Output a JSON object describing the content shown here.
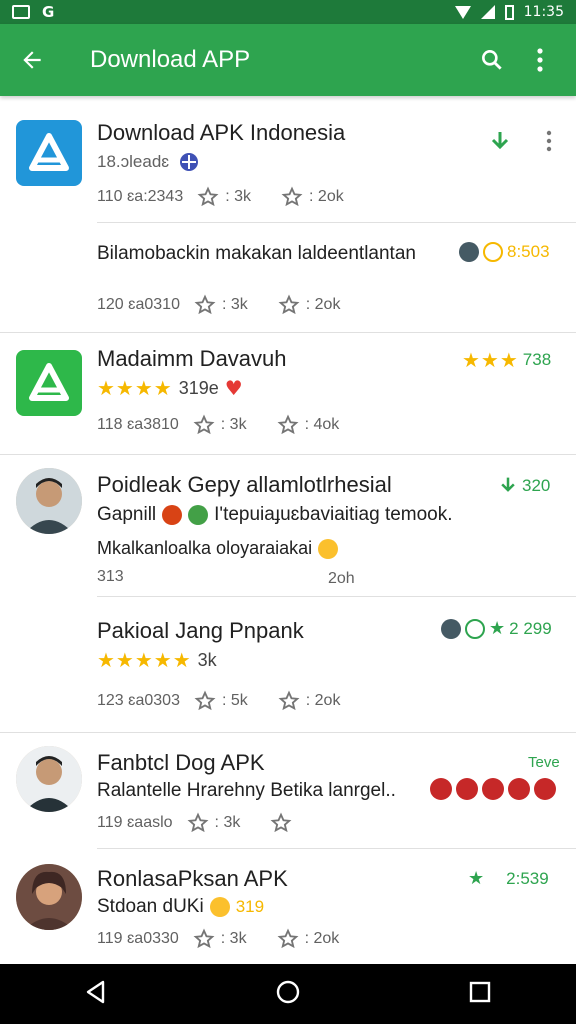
{
  "status_bar": {
    "time": "11:35"
  },
  "app_bar": {
    "title": "Download APP"
  },
  "items": [
    {
      "title": "Download APK Indonesia",
      "subtitle": "18.ɔleadɛ",
      "meta": "110 ɛa:2343",
      "stat1": ": 3k",
      "stat2": ": 2ok"
    },
    {
      "title": "Bilamobackin makakan laldeentlantan",
      "right_value": "8:503",
      "meta": "120 ɛa0310",
      "stat1": ": 3k",
      "stat2": ": 2ok"
    },
    {
      "title": "Madaimm Davavuh",
      "subtitle": "319e",
      "right_value": "738",
      "meta": "118 ɛa3810",
      "stat1": ": 3k",
      "stat2": ": 4ok"
    },
    {
      "title": "Poidleak Gepy allamlotlrhesial",
      "right_value": "320",
      "line2": "Gapnill",
      "line2b": "I'tepuiaɟuɛbaviaitiag temook.",
      "line3": "Mkalkanloalka oloyaraiakai",
      "meta": "313",
      "stat2": "2oh"
    },
    {
      "title": "Pakioal Jang Pnpank",
      "subtitle": "3k",
      "right_value": "2 299",
      "meta": "123 ɛa0303",
      "stat1": ": 5k",
      "stat2": ": 2ok"
    },
    {
      "title": "Fanbtcl Dog APK",
      "subtitle": "Ralantelle Hrarehny Betika lanrgel..",
      "right_value": "Teve",
      "meta": "119 ɛaaslo",
      "stat1": ": 3k"
    },
    {
      "title": "RonlasaPksan APK",
      "subtitle": "Stdoan dUKi",
      "subtitle_b": "319",
      "right_value": "2:539",
      "meta": "119 ɛa0330",
      "stat1": ": 3k",
      "stat2": ": 2ok"
    }
  ],
  "colors": {
    "green": "#2ea44f",
    "dark_green": "#1e7a3a",
    "star": "#f6b800"
  }
}
